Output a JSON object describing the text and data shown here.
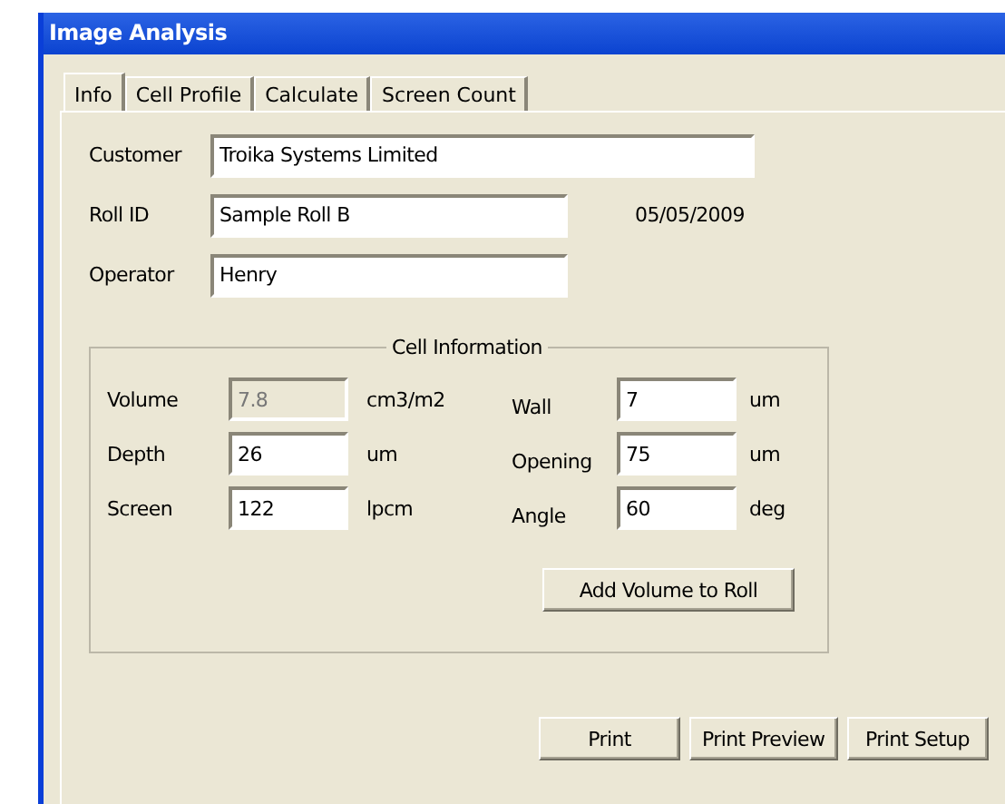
{
  "window": {
    "title": "Image Analysis"
  },
  "tabs": [
    {
      "label": "Info",
      "selected": true
    },
    {
      "label": "Cell Profile",
      "selected": false
    },
    {
      "label": "Calculate",
      "selected": false
    },
    {
      "label": "Screen Count",
      "selected": false
    }
  ],
  "info": {
    "customer": {
      "label": "Customer",
      "value": "Troika Systems Limited"
    },
    "roll_id": {
      "label": "Roll ID",
      "value": "Sample Roll B"
    },
    "date": "05/05/2009",
    "operator": {
      "label": "Operator",
      "value": "Henry"
    }
  },
  "cell_information": {
    "title": "Cell Information",
    "fields": [
      {
        "label": "Volume",
        "value": "7.8",
        "unit": "cm3/m2",
        "disabled": true
      },
      {
        "label": "Wall",
        "value": "7",
        "unit": "um",
        "disabled": false
      },
      {
        "label": "Depth",
        "value": "26",
        "unit": "um",
        "disabled": false
      },
      {
        "label": "Opening",
        "value": "75",
        "unit": "um",
        "disabled": false
      },
      {
        "label": "Screen",
        "value": "122",
        "unit": "lpcm",
        "disabled": false
      },
      {
        "label": "Angle",
        "value": "60",
        "unit": "deg",
        "disabled": false
      }
    ],
    "button": "Add Volume to Roll"
  },
  "buttons": [
    "Print",
    "Print Preview",
    "Print Setup"
  ]
}
